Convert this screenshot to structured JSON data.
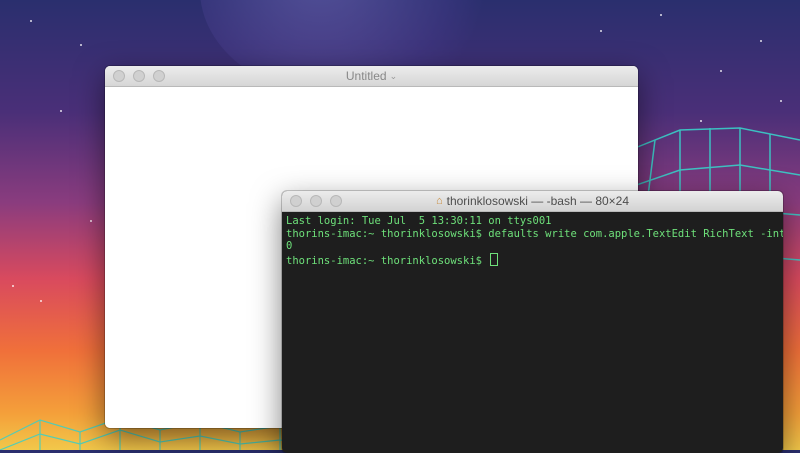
{
  "textedit": {
    "title": "Untitled",
    "title_chevron": "⌄"
  },
  "terminal": {
    "title": "thorinklosowski — -bash — 80×24",
    "lines": [
      "Last login: Tue Jul  5 13:30:11 on ttys001",
      "thorins-imac:~ thorinklosowski$ defaults write com.apple.TextEdit RichText -int",
      "0",
      "thorins-imac:~ thorinklosowski$ "
    ]
  },
  "colors": {
    "terminal_text": "#6ee07a",
    "terminal_bg": "#1e1e1e",
    "grid_lines": "#39d0c9"
  },
  "icons": [
    "home-icon",
    "chevron-down-icon"
  ]
}
